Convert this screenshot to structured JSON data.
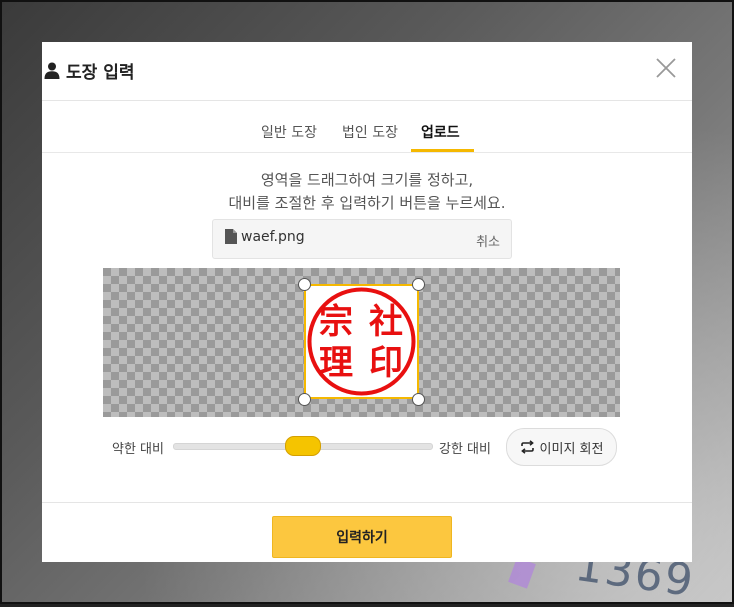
{
  "modal": {
    "title": "도장 입력",
    "title_icon": "user-icon",
    "close_icon": "close-icon"
  },
  "tabs": [
    {
      "label": "일반 도장",
      "active": false
    },
    {
      "label": "법인 도장",
      "active": false
    },
    {
      "label": "업로드",
      "active": true
    }
  ],
  "instructions": {
    "line1": "영역을 드래그하여 크기를 정하고,",
    "line2": "대비를 조절한 후 입력하기 버튼을 누르세요."
  },
  "file": {
    "icon": "file-icon",
    "name": "waef.png",
    "cancel_label": "취소"
  },
  "stamp": {
    "chars": [
      "宗",
      "社",
      "理",
      "印"
    ],
    "color": "#e81010"
  },
  "contrast": {
    "weak_label": "약한 대비",
    "strong_label": "강한 대비",
    "value": 0.5
  },
  "rotate_button": {
    "label": "이미지 회전",
    "icon": "rotate-icon"
  },
  "submit_label": "입력하기",
  "colors": {
    "accent": "#f5b800",
    "button": "#fcc73f"
  }
}
